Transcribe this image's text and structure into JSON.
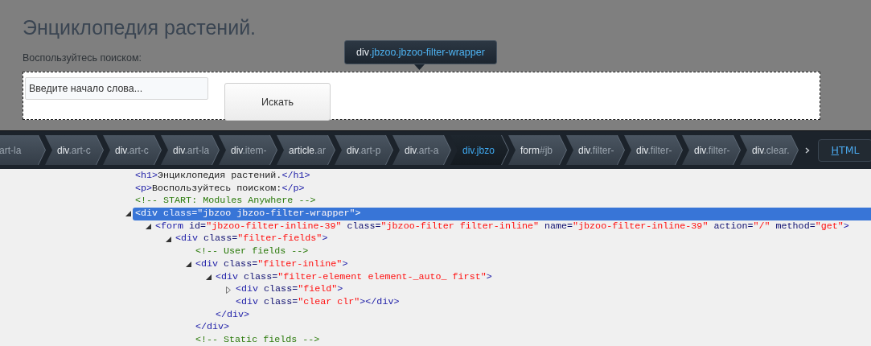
{
  "page": {
    "title": "Энциклопедия растений.",
    "subtitle": "Воспользуйтесь поиском:",
    "search": {
      "placeholder": "Введите начало слова..."
    },
    "search_button": "Искать"
  },
  "tooltip": {
    "tag": "div",
    "rest": ".jbzoo.jbzoo-filter-wrapper"
  },
  "breadcrumbs": [
    {
      "rest": "art-la",
      "selected": false
    },
    {
      "tag": "div",
      "rest": ".art-c",
      "selected": false
    },
    {
      "tag": "div",
      "rest": ".art-c",
      "selected": false
    },
    {
      "tag": "div",
      "rest": ".art-la",
      "selected": false
    },
    {
      "tag": "div",
      "rest": ".item-",
      "selected": false
    },
    {
      "tag": "article",
      "rest": ".ar",
      "selected": false
    },
    {
      "tag": "div",
      "rest": ".art-p",
      "selected": false
    },
    {
      "tag": "div",
      "rest": ".art-a",
      "selected": false
    },
    {
      "tag": "div",
      "rest": ".jbzo",
      "selected": true
    },
    {
      "tag": "form",
      "rest": "#jb",
      "selected": false
    },
    {
      "tag": "div",
      "rest": ".filter-",
      "selected": false
    },
    {
      "tag": "div",
      "rest": ".filter-",
      "selected": false
    },
    {
      "tag": "div",
      "rest": ".filter-",
      "selected": false
    },
    {
      "tag": "div",
      "rest": ".clear.",
      "selected": false
    }
  ],
  "view_button": {
    "access_key": "H",
    "rest": "TML"
  },
  "tree": [
    {
      "tokens": [
        {
          "kind": "tag",
          "text": "<h1>"
        },
        {
          "kind": "text",
          "text": "Энциклопедия растений."
        },
        {
          "kind": "tag",
          "text": "</h1>"
        }
      ],
      "selected": false
    },
    {
      "tokens": [
        {
          "kind": "tag",
          "text": "<p>"
        },
        {
          "kind": "text",
          "text": "Воспользуйтесь поиском:"
        },
        {
          "kind": "tag",
          "text": "</p>"
        }
      ],
      "selected": false
    },
    {
      "tokens": [
        {
          "kind": "comment",
          "text": "<!-- START: Modules Anywhere -->"
        }
      ],
      "selected": false
    },
    {
      "tokens": [
        {
          "kind": "tag",
          "text": "<div"
        },
        {
          "kind": "attr",
          "text": " class="
        },
        {
          "kind": "value",
          "text": "\"jbzoo jbzoo-filter-wrapper\""
        },
        {
          "kind": "tag",
          "text": ">"
        }
      ],
      "selected": true,
      "expanded": true,
      "children": [
        {
          "tokens": [
            {
              "kind": "tag",
              "text": "<form"
            },
            {
              "kind": "attr",
              "text": " id="
            },
            {
              "kind": "value",
              "text": "\"jbzoo-filter-inline-39\""
            },
            {
              "kind": "attr",
              "text": " class="
            },
            {
              "kind": "value",
              "text": "\"jbzoo-filter filter-inline\""
            },
            {
              "kind": "attr",
              "text": " name="
            },
            {
              "kind": "value",
              "text": "\"jbzoo-filter-inline-39\""
            },
            {
              "kind": "attr",
              "text": " action="
            },
            {
              "kind": "value",
              "text": "\"/\""
            },
            {
              "kind": "attr",
              "text": " method="
            },
            {
              "kind": "value",
              "text": "\"get\""
            },
            {
              "kind": "tag",
              "text": ">"
            }
          ],
          "selected": false,
          "expanded": true,
          "children": [
            {
              "tokens": [
                {
                  "kind": "tag",
                  "text": "<div"
                },
                {
                  "kind": "attr",
                  "text": " class="
                },
                {
                  "kind": "value",
                  "text": "\"filter-fields\""
                },
                {
                  "kind": "tag",
                  "text": ">"
                }
              ],
              "selected": false,
              "expanded": true,
              "children": [
                {
                  "tokens": [
                    {
                      "kind": "comment",
                      "text": "<!-- User fields -->"
                    }
                  ],
                  "selected": false
                },
                {
                  "tokens": [
                    {
                      "kind": "tag",
                      "text": "<div"
                    },
                    {
                      "kind": "attr",
                      "text": " class="
                    },
                    {
                      "kind": "value",
                      "text": "\"filter-inline\""
                    },
                    {
                      "kind": "tag",
                      "text": ">"
                    }
                  ],
                  "selected": false,
                  "expanded": true,
                  "children": [
                    {
                      "tokens": [
                        {
                          "kind": "tag",
                          "text": "<div"
                        },
                        {
                          "kind": "attr",
                          "text": " class="
                        },
                        {
                          "kind": "value",
                          "text": "\"filter-element element-_auto_ first\""
                        },
                        {
                          "kind": "tag",
                          "text": ">"
                        }
                      ],
                      "selected": false,
                      "expanded": true,
                      "children": [
                        {
                          "tokens": [
                            {
                              "kind": "tag",
                              "text": "<div"
                            },
                            {
                              "kind": "attr",
                              "text": " class="
                            },
                            {
                              "kind": "value",
                              "text": "\"field\""
                            },
                            {
                              "kind": "tag",
                              "text": ">"
                            }
                          ],
                          "selected": false,
                          "expanded": false
                        },
                        {
                          "tokens": [
                            {
                              "kind": "tag",
                              "text": "<div"
                            },
                            {
                              "kind": "attr",
                              "text": " class="
                            },
                            {
                              "kind": "value",
                              "text": "\"clear clr\""
                            },
                            {
                              "kind": "tag",
                              "text": "></div>"
                            }
                          ],
                          "selected": false
                        }
                      ],
                      "close": [
                        {
                          "kind": "tag",
                          "text": "</div>"
                        }
                      ]
                    }
                  ],
                  "close": [
                    {
                      "kind": "tag",
                      "text": "</div>"
                    }
                  ]
                },
                {
                  "tokens": [
                    {
                      "kind": "comment",
                      "text": "<!-- Static fields -->"
                    }
                  ],
                  "selected": false
                }
              ]
            }
          ]
        }
      ]
    }
  ]
}
